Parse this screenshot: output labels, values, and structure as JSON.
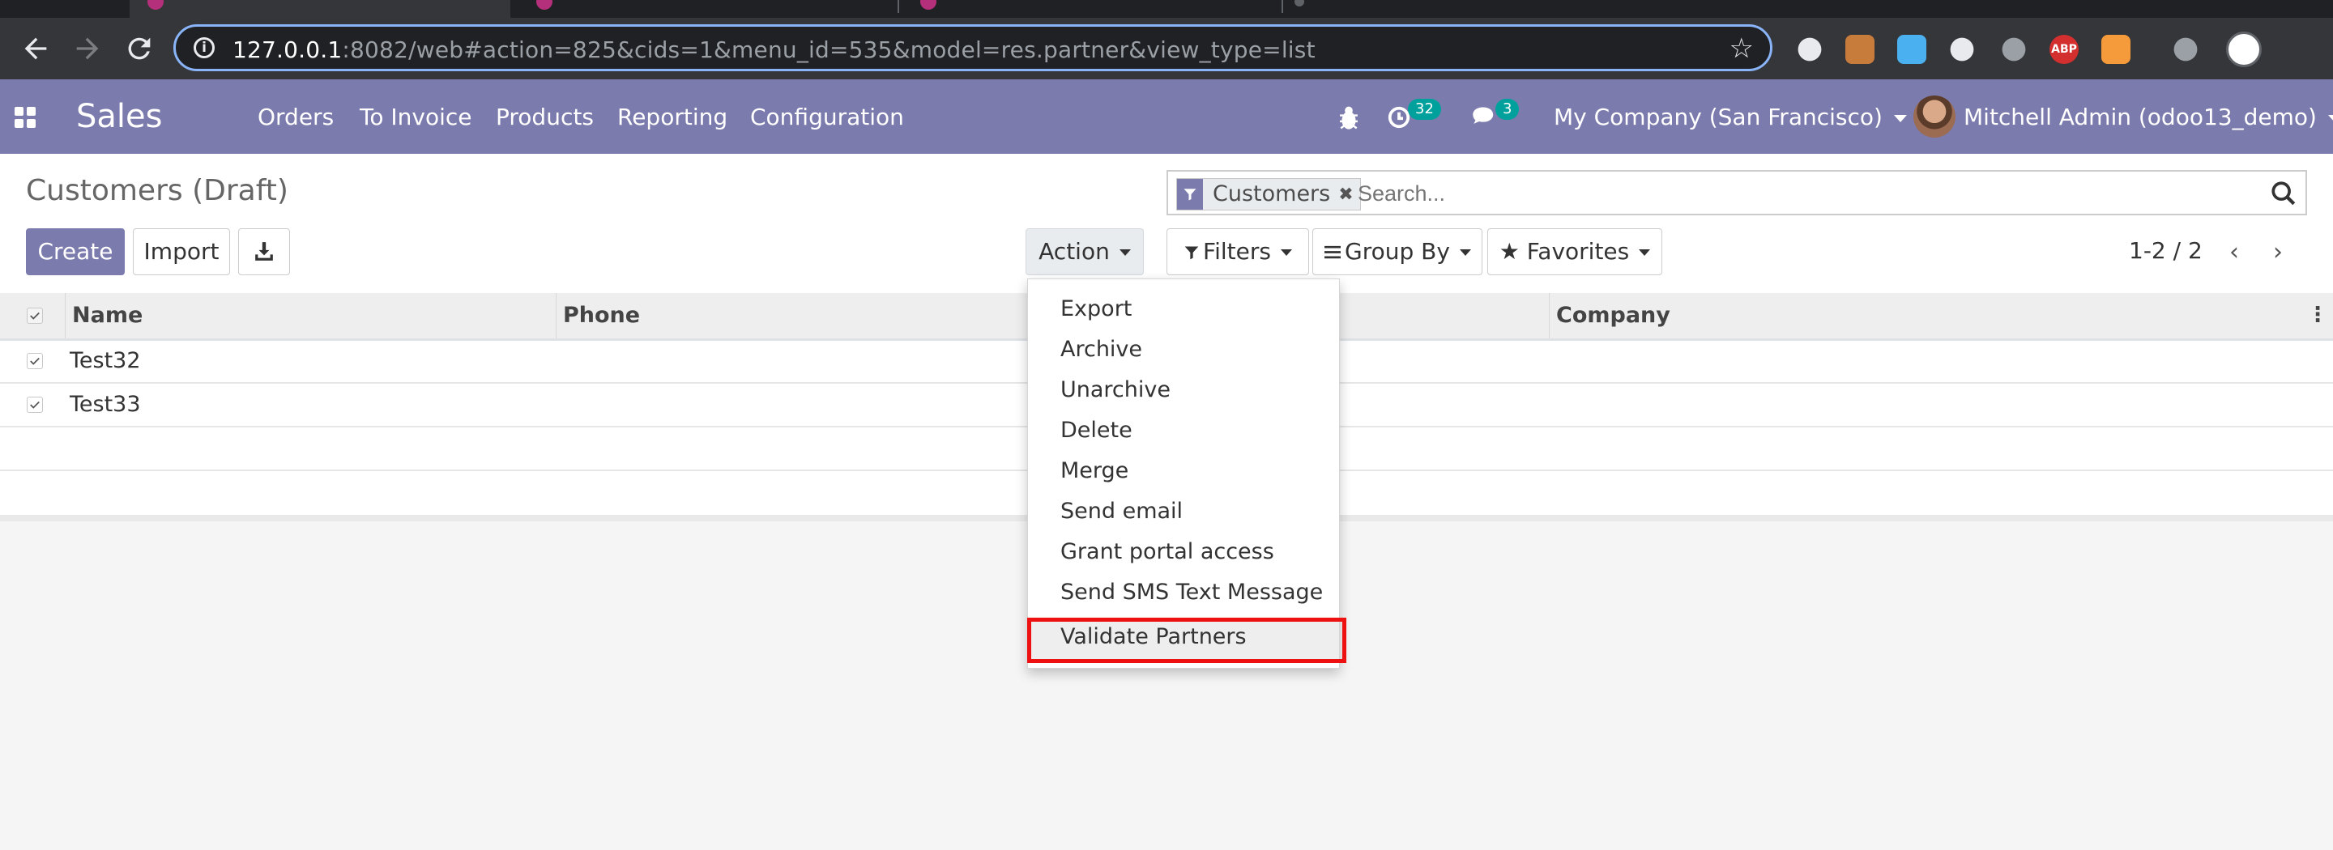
{
  "browser": {
    "url_host": "127.0.0.1",
    "url_rest": ":8082/web#action=825&cids=1&menu_id=535&model=res.partner&view_type=list",
    "extensions": [
      {
        "name": "cloud-icon",
        "color": "#e8eaed",
        "glyph": ""
      },
      {
        "name": "monkey-icon",
        "color": "#c77c3c",
        "glyph": ""
      },
      {
        "name": "color-ring-icon",
        "color": "#4ab0f0",
        "glyph": ""
      },
      {
        "name": "grid-extension-icon",
        "color": "#e8eaed",
        "glyph": ""
      },
      {
        "name": "bulb-icon",
        "color": "#9aa0a6",
        "glyph": ""
      },
      {
        "name": "adblock-icon",
        "color": "#d32f2f",
        "glyph": "ABP"
      },
      {
        "name": "orange-extension-icon",
        "color": "#f59b3b",
        "glyph": ""
      },
      {
        "name": "playlist-icon",
        "color": "#9aa0a6",
        "glyph": ""
      }
    ]
  },
  "navbar": {
    "brand": "Sales",
    "menu": [
      "Orders",
      "To Invoice",
      "Products",
      "Reporting",
      "Configuration"
    ],
    "activity_count": "32",
    "message_count": "3",
    "company": "My Company (San Francisco)",
    "user": "Mitchell Admin (odoo13_demo)"
  },
  "control_panel": {
    "breadcrumb": "Customers (Draft)",
    "create_label": "Create",
    "import_label": "Import",
    "action_label": "Action",
    "filters_label": "Filters",
    "groupby_label": "Group By",
    "favorites_label": "Favorites",
    "search_facet": "Customers",
    "search_placeholder": "Search...",
    "pager": "1-2 / 2"
  },
  "list": {
    "columns": [
      "Name",
      "Phone",
      "Company"
    ],
    "rows": [
      {
        "name": "Test32",
        "phone": "",
        "company": ""
      },
      {
        "name": "Test33",
        "phone": "",
        "company": ""
      }
    ]
  },
  "action_menu": {
    "items": [
      "Export",
      "Archive",
      "Unarchive",
      "Delete",
      "Merge",
      "Send email",
      "Grant portal access",
      "Send SMS Text Message",
      "Validate Partners"
    ],
    "highlighted": "Validate Partners"
  },
  "colors": {
    "brand": "#7c7bad",
    "badge": "#00a09d",
    "highlight": "#ee1111"
  }
}
